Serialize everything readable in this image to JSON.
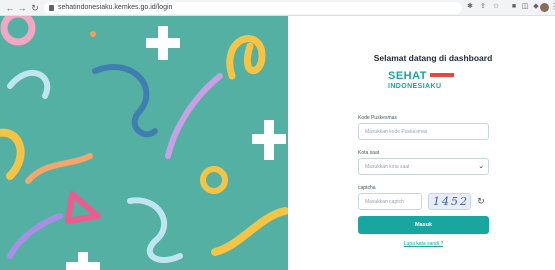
{
  "browser": {
    "url": "sehatindonesiaku.kemkes.go.id/login",
    "nav_back": "←",
    "nav_forward": "→",
    "nav_reload": "↻",
    "menu": "⋮"
  },
  "login": {
    "welcome": "Selamat datang di dashboard",
    "logo_sehat": "SEHAT",
    "logo_indonesiaku": "INDONESIAKU",
    "kode_label": "Kode Puskesmas",
    "kode_placeholder": "Masukkan kode Puskesmas",
    "kota_label": "Kota saat",
    "kota_placeholder": "Masukkan kota saat",
    "captcha_label": "captcha",
    "captcha_placeholder": "Masukkan captch",
    "captcha_value": "1452",
    "submit_label": "Masuk",
    "forgot_label": "Lupa kata sandi ?"
  },
  "colors": {
    "hero_bg": "#55b0a4",
    "brand": "#1aa6a0",
    "brand_accent": "#e8483d"
  }
}
